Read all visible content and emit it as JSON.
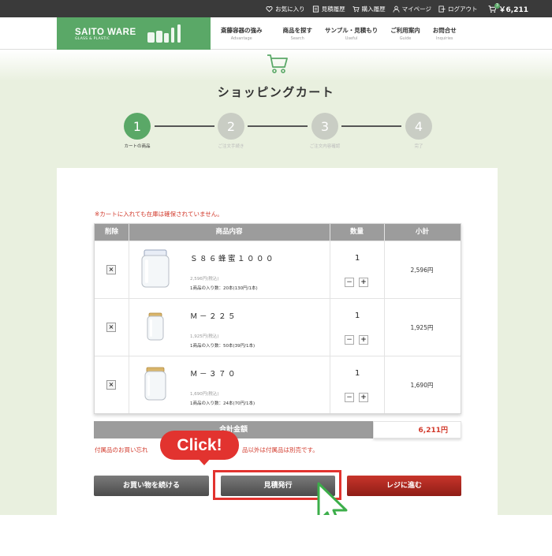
{
  "topbar": {
    "favorites": "お気に入り",
    "quote_history": "見積履歴",
    "purchase_history": "購入履歴",
    "mypage": "マイページ",
    "logout": "ログアウト",
    "cart_badge": "3",
    "cart_total": "￥6,211"
  },
  "header": {
    "logo_name": "SAITO WARE",
    "logo_sub": "GLASS & PLASTIC",
    "nav": [
      {
        "ja": "斎藤容器の強み",
        "en": "Advantage"
      },
      {
        "ja": "商品を探す",
        "en": "Search"
      },
      {
        "ja": "サンプル・見積もり",
        "en": "Useful"
      },
      {
        "ja": "ご利用案内",
        "en": "Guide"
      },
      {
        "ja": "お問合せ",
        "en": "Inquiries"
      }
    ]
  },
  "page": {
    "title": "ショッピングカート"
  },
  "steps": [
    {
      "num": "1",
      "label": "カートの商品"
    },
    {
      "num": "2",
      "label": "ご注文手続き"
    },
    {
      "num": "3",
      "label": "ご注文内容確認"
    },
    {
      "num": "4",
      "label": "完了"
    }
  ],
  "cart": {
    "notice": "※カートに入れても在庫は確保されていません。",
    "headers": {
      "del": "削除",
      "item": "商品内容",
      "qty": "数量",
      "subtotal": "小計"
    },
    "items": [
      {
        "name": "Ｓ８６蜂蜜１０００",
        "price": "2,596円(税込)",
        "qty_text": "1商品の入り数：20本(130円/1本)",
        "qty": "1",
        "subtotal": "2,596円"
      },
      {
        "name": "Ｍ－２２５",
        "price": "1,925円(税込)",
        "qty_text": "1商品の入り数：50本(39円/1本)",
        "qty": "1",
        "subtotal": "1,925円"
      },
      {
        "name": "Ｍ－３７０",
        "price": "1,690円(税込)",
        "qty_text": "1商品の入り数：24本(70円/1本)",
        "qty": "1",
        "subtotal": "1,690円"
      }
    ],
    "del_symbol": "×",
    "minus_symbol": "−",
    "plus_symbol": "+",
    "total_label": "合計金額",
    "total_value": "6,211円",
    "note_before": "付属品のお買い忘れ",
    "note_after": "品以外は付属品は別売です。"
  },
  "buttons": {
    "continue": "お買い物を続ける",
    "quote": "見積発行",
    "checkout": "レジに進む"
  },
  "callout": {
    "text": "Click!"
  },
  "colors": {
    "brand_green": "#5aa867",
    "accent_red": "#e2332f",
    "checkout_red": "#b12a21"
  }
}
